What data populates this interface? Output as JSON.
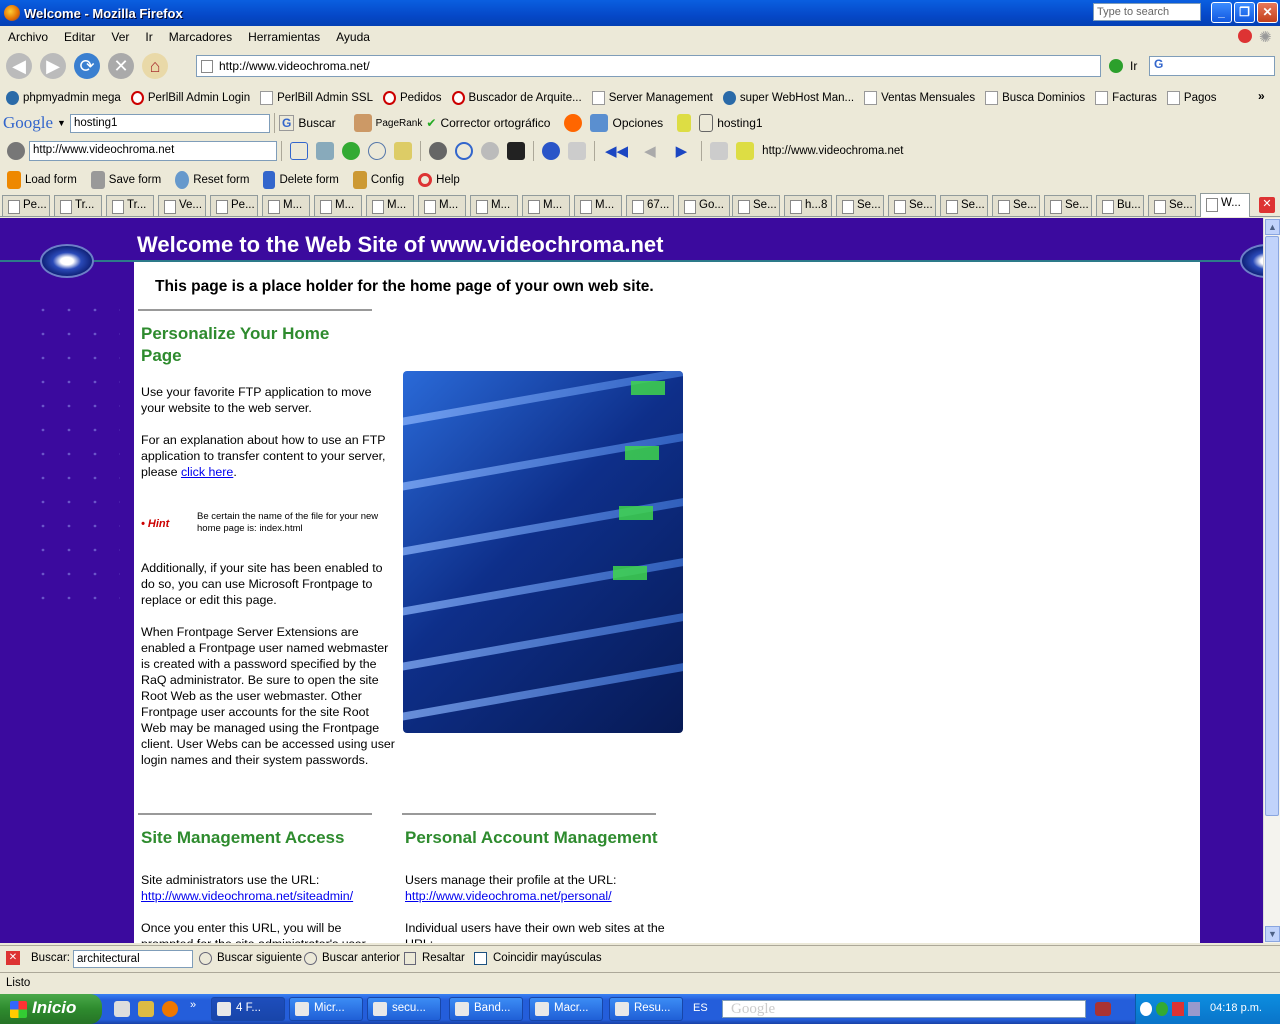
{
  "window": {
    "title": "Welcome - Mozilla Firefox",
    "search_placeholder": "Type to search"
  },
  "menu": [
    "Archivo",
    "Editar",
    "Ver",
    "Ir",
    "Marcadores",
    "Herramientas",
    "Ayuda"
  ],
  "nav": {
    "url": "http://www.videochroma.net/",
    "go": "Ir"
  },
  "bookmarks": [
    "phpmyadmin mega",
    "PerlBill Admin Login",
    "PerlBill Admin SSL",
    "Pedidos",
    "Buscador de Arquite...",
    "Server Management",
    "super WebHost Man...",
    "Ventas Mensuales",
    "Busca Dominios",
    "Facturas",
    "Pagos"
  ],
  "google_toolbar": {
    "logo": "Google",
    "query": "hosting1",
    "search": "Buscar",
    "pagerank": "PageRank",
    "spell": "Corrector ortográfico",
    "options": "Opciones",
    "last": "hosting1"
  },
  "toolbar2": {
    "url": "http://www.videochroma.net",
    "right_url": "http://www.videochroma.net"
  },
  "formbar": [
    "Load form",
    "Save form",
    "Reset form",
    "Delete form",
    "Config",
    "Help"
  ],
  "tabs": [
    "Pe...",
    "Tr...",
    "Tr...",
    "Ve...",
    "Pe...",
    "M...",
    "M...",
    "M...",
    "M...",
    "M...",
    "M...",
    "M...",
    "67...",
    "Go...",
    "Se...",
    "h...8",
    "Se...",
    "Se...",
    "Se...",
    "Se...",
    "Se...",
    "Bu...",
    "Se...",
    "W..."
  ],
  "page": {
    "header": "Welcome to the Web Site of www.videochroma.net",
    "placeholder": "This page is a place holder for the home page of your own web site.",
    "personalize_title": "Personalize Your Home Page",
    "p1": "Use your favorite FTP application to move your website to the web server.",
    "p2_pre": "For an explanation about how to use an FTP application to transfer content to your server, please ",
    "p2_link": "click here",
    "p2_post": ".",
    "hint_label": "• Hint",
    "hint_text": "Be certain the name of the file for your new home page is: index.html",
    "p3": "Additionally, if your site has been enabled to do so, you can use Microsoft Frontpage to replace or edit this page.",
    "p4": "When Frontpage Server Extensions are enabled a Frontpage user named webmaster is created with a password specified by the RaQ administrator. Be sure to open the site Root Web as the user webmaster. Other Frontpage user accounts for the site Root Web may be managed using the Frontpage client. User Webs can be accessed using user login names and their system passwords.",
    "site_title": "Site Management Access",
    "site_p1": "Site administrators use the URL:",
    "site_link": "http://www.videochroma.net/siteadmin/",
    "site_p2": "Once you enter this URL, you will be prompted for the site administrator's user",
    "personal_title": "Personal Account Management",
    "personal_p1": "Users manage their profile at the URL:",
    "personal_link": "http://www.videochroma.net/personal/",
    "personal_p2": "Individual users have their own web sites at the URL:"
  },
  "findbar": {
    "label": "Buscar:",
    "value": "architectural",
    "next": "Buscar siguiente",
    "prev": "Buscar anterior",
    "highlight": "Resaltar",
    "match_case": "Coincidir mayúsculas"
  },
  "status": "Listo",
  "taskbar": {
    "start": "Inicio",
    "items": [
      "4 F...",
      "Micr...",
      "secu...",
      "Band...",
      "Macr...",
      "Resu..."
    ],
    "lang": "ES",
    "search": "Google",
    "clock": "04:18 p.m."
  }
}
